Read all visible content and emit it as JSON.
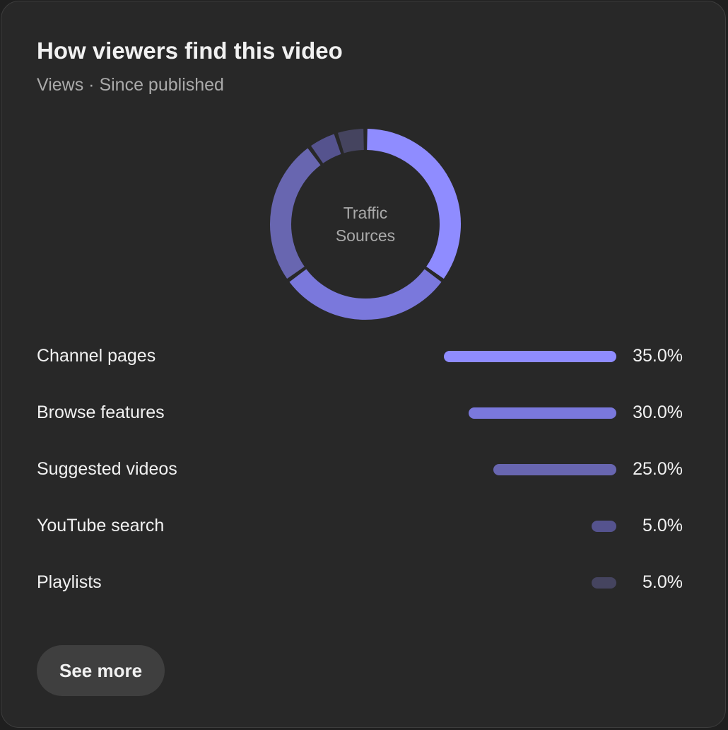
{
  "card": {
    "title": "How viewers find this video",
    "subtitle": "Views · Since published",
    "see_more_label": "See more"
  },
  "chart_data": {
    "type": "donut",
    "center_label_line1": "Traffic",
    "center_label_line2": "Sources",
    "categories": [
      "Channel pages",
      "Browse features",
      "Suggested videos",
      "YouTube search",
      "Playlists"
    ],
    "values": [
      35.0,
      30.0,
      25.0,
      5.0,
      5.0
    ],
    "value_labels": [
      "35.0%",
      "30.0%",
      "25.0%",
      "5.0%",
      "5.0%"
    ],
    "unit": "%",
    "colors": [
      "#8f8cff",
      "#7a78dc",
      "#6866b0",
      "#55538e",
      "#45445f"
    ]
  }
}
